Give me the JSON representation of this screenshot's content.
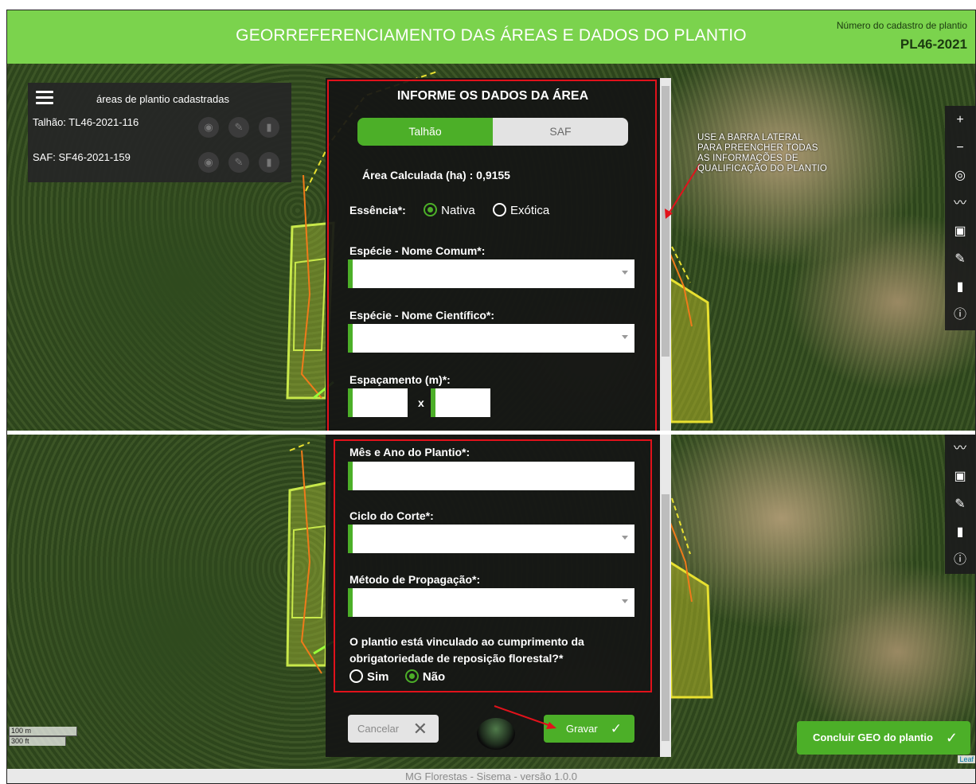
{
  "header": {
    "title": "GEORREFERENCIAMENTO DAS ÁREAS E DADOS DO PLANTIO",
    "cadastro_label": "Número do cadastro de plantio",
    "cadastro_numero": "PL46-2021"
  },
  "areas_panel": {
    "title": "áreas de plantio cadastradas",
    "items": [
      {
        "label": "Talhão: TL46-2021-116"
      },
      {
        "label": "SAF: SF46-2021-159"
      }
    ]
  },
  "form_top": {
    "title": "INFORME OS DADOS DA ÁREA",
    "tabs": [
      "Talhão",
      "SAF"
    ],
    "active_tab": "Talhão",
    "area_calculada": "Área Calculada (ha) : 0,9155",
    "essencia_label": "Essência*:",
    "essencia_options": [
      "Nativa",
      "Exótica"
    ],
    "essencia_selected": "Nativa",
    "especie_comum_label": "Espécie - Nome Comum*:",
    "especie_cientifico_label": "Espécie - Nome Científico*:",
    "espacamento_label": "Espaçamento (m)*:",
    "espacamento_sep": "x"
  },
  "form_bottom": {
    "mes_ano_label": "Mês e Ano do Plantio*:",
    "ciclo_label": "Ciclo do Corte*:",
    "metodo_label": "Método de Propagação*:",
    "vinculo_label_line1": "O plantio está vinculado ao cumprimento da",
    "vinculo_label_line2": "obrigatoriedade de reposição florestal?*",
    "vinculo_options": [
      "Sim",
      "Não"
    ],
    "vinculo_selected": "Não",
    "cancel_label": "Cancelar",
    "save_label": "Gravar"
  },
  "annotation": {
    "lines": [
      "USE A BARRA LATERAL",
      "PARA PREENCHER TODAS",
      "AS INFORMAÇÕES DE",
      "QUALIFICAÇÃO DO PLANTIO"
    ]
  },
  "map_controls": {
    "top": [
      "zoom-in",
      "zoom-out",
      "locate",
      "polyline",
      "rectangle",
      "edit",
      "delete",
      "info"
    ],
    "bottom": [
      "polyline",
      "rectangle",
      "edit",
      "delete",
      "info"
    ]
  },
  "concluir_label": "Concluir GEO do plantio",
  "scale": {
    "metric": "100 m",
    "imperial": "300 ft"
  },
  "leaflet": "Leaf",
  "footer": "MG Florestas - Sisema - versão 1.0.0",
  "colors": {
    "accent": "#4caf28",
    "header": "#7bd34d",
    "highlight": "#e1121b",
    "panel": "#262626"
  }
}
